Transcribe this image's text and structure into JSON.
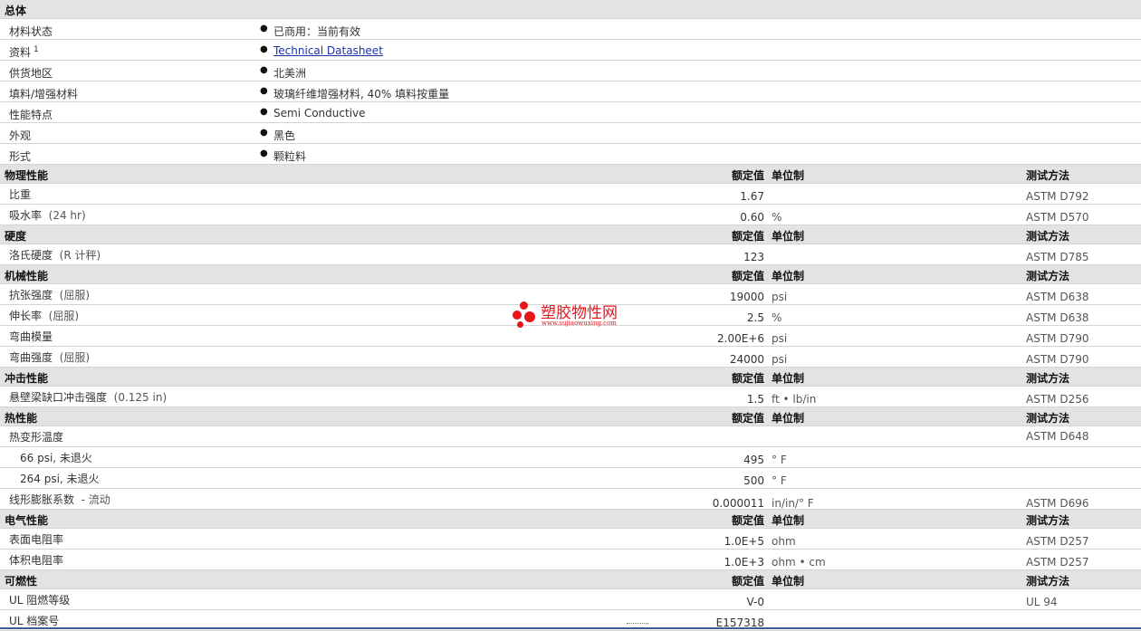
{
  "general": {
    "title": "总体",
    "rows": [
      {
        "label": "材料状态",
        "value": "已商用：当前有效"
      },
      {
        "label": "资料",
        "note": "1",
        "value": "Technical Datasheet",
        "link": true
      },
      {
        "label": "供货地区",
        "value": "北美洲"
      },
      {
        "label": "填料/增强材料",
        "value": "玻璃纤维增强材料, 40% 填料按重量"
      },
      {
        "label": "性能特点",
        "value": "Semi Conductive"
      },
      {
        "label": "外观",
        "value": "黑色"
      },
      {
        "label": "形式",
        "value": "颗粒料"
      }
    ]
  },
  "headers": {
    "value": "额定值",
    "unit": "单位制",
    "method": "测试方法"
  },
  "sections": [
    {
      "title": "物理性能",
      "rows": [
        {
          "label": "比重",
          "value": "1.67",
          "unit": "",
          "method": "ASTM D792"
        },
        {
          "label": "吸水率",
          "cond": "(24 hr)",
          "value": "0.60",
          "unit": "%",
          "method": "ASTM D570"
        }
      ]
    },
    {
      "title": "硬度",
      "rows": [
        {
          "label": "洛氏硬度",
          "cond": "(R 计秤)",
          "value": "123",
          "unit": "",
          "method": "ASTM D785"
        }
      ]
    },
    {
      "title": "机械性能",
      "rows": [
        {
          "label": "抗张强度",
          "cond": "(屈服)",
          "value": "19000",
          "unit": "psi",
          "method": "ASTM D638"
        },
        {
          "label": "伸长率",
          "cond": "(屈服)",
          "value": "2.5",
          "unit": "%",
          "method": "ASTM D638"
        },
        {
          "label": "弯曲模量",
          "value": "2.00E+6",
          "unit": "psi",
          "method": "ASTM D790"
        },
        {
          "label": "弯曲强度",
          "cond": "(屈服)",
          "value": "24000",
          "unit": "psi",
          "method": "ASTM D790"
        }
      ]
    },
    {
      "title": "冲击性能",
      "rows": [
        {
          "label": "悬壁梁缺口冲击强度",
          "cond": "(0.125 in)",
          "value": "1.5",
          "unit": "ft • lb/in",
          "method": "ASTM D256"
        }
      ]
    },
    {
      "title": "热性能",
      "rows": [
        {
          "label": "热变形温度",
          "value": "",
          "unit": "",
          "method": "ASTM D648",
          "pos": "top"
        },
        {
          "label": "66 psi, 未退火",
          "sub": true,
          "value": "495",
          "unit": "° F",
          "method": ""
        },
        {
          "label": "264 psi, 未退火",
          "sub": true,
          "value": "500",
          "unit": "° F",
          "method": ""
        },
        {
          "label": "线形膨胀系数",
          "cond": "- 流动",
          "value": "0.000011",
          "unit": "in/in/° F",
          "method": "ASTM D696",
          "pos": "mid"
        }
      ]
    },
    {
      "title": "电气性能",
      "rows": [
        {
          "label": "表面电阻率",
          "value": "1.0E+5",
          "unit": "ohm",
          "method": "ASTM D257"
        },
        {
          "label": "体积电阻率",
          "value": "1.0E+3",
          "unit": "ohm • cm",
          "method": "ASTM D257"
        }
      ]
    },
    {
      "title": "可燃性",
      "rows": [
        {
          "label": "UL 阻燃等级",
          "value": "V-0",
          "unit": "",
          "method": "UL 94"
        },
        {
          "label": "UL 档案号",
          "value": "E157318",
          "unit": "",
          "method": ""
        }
      ]
    }
  ],
  "watermark": {
    "name": "塑胶物性网",
    "url": "www.sujiaowuxing.com",
    "color": "#e8141c"
  },
  "icons": {
    "bullet": "bullet-icon",
    "logo": "logo-dots-icon"
  }
}
